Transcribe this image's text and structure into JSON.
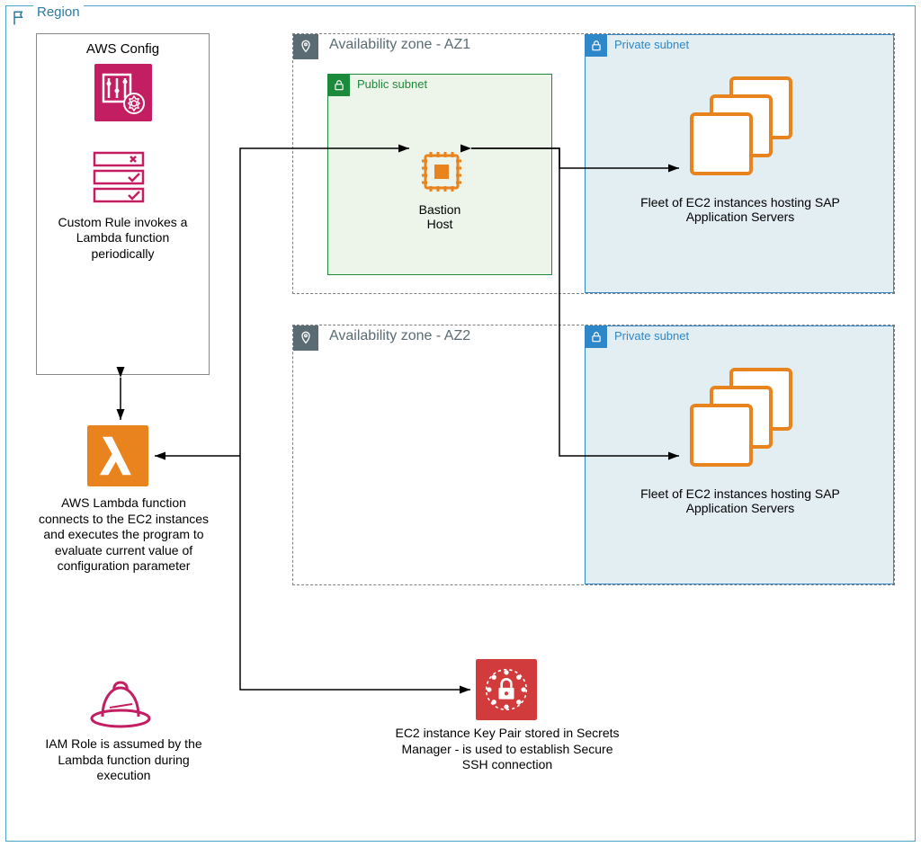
{
  "region": {
    "label": "Region"
  },
  "config_group": {
    "title": "AWS Config",
    "rule_text": "Custom  Rule invokes a Lambda function periodically"
  },
  "lambda_text": "AWS Lambda function connects to the EC2 instances and executes the program to evaluate current value of configuration parameter",
  "iam_text": "IAM Role is assumed by the Lambda function during execution",
  "secrets_text": "EC2 instance Key Pair stored in Secrets Manager - is used to establish Secure SSH connection",
  "az1": {
    "title": "Availability zone - AZ1",
    "public_label": "Public subnet",
    "bastion_label": "Bastion\nHost",
    "private_label": "Private subnet",
    "fleet_label": "Fleet of EC2 instances hosting SAP Application Servers"
  },
  "az2": {
    "title": "Availability zone - AZ2",
    "private_label": "Private subnet",
    "fleet_label": "Fleet of EC2 instances hosting SAP Application Servers"
  }
}
